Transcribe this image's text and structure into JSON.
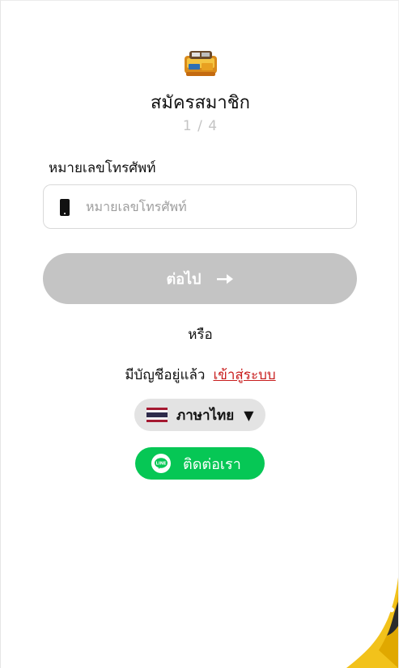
{
  "header": {
    "title": "สมัครสมาชิก",
    "step": "1 / 4"
  },
  "form": {
    "phone_label": "หมายเลขโทรศัพท์",
    "phone_placeholder": "หมายเลขโทรศัพท์",
    "phone_value": "",
    "next_label": "ต่อไป"
  },
  "or_text": "หรือ",
  "login": {
    "prompt": "มีบัญชีอยู่แล้ว",
    "link": "เข้าสู่ระบบ"
  },
  "language": {
    "selected": "ภาษาไทย",
    "caret": "▼"
  },
  "contact": {
    "label": "ติดต่อเรา",
    "icon_text": "LINE"
  },
  "icons": {
    "phone": "smartphone-icon",
    "arrow": "arrow-right-icon",
    "flag": "thailand-flag-icon",
    "line": "line-app-icon"
  },
  "colors": {
    "next_button_disabled": "#c4c4c4",
    "link_red": "#c81d1d",
    "line_green": "#06c755",
    "language_bg": "#e3e3e3"
  }
}
